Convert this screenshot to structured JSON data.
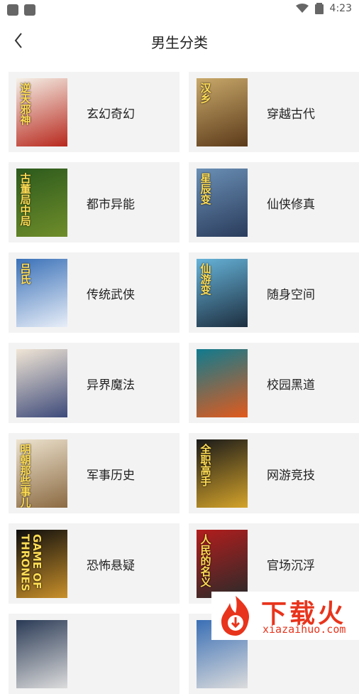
{
  "status_bar": {
    "time": "4:23"
  },
  "header": {
    "title": "男生分类",
    "back_icon": "chevron-left-icon"
  },
  "categories": [
    {
      "label": "玄幻奇幻",
      "cover_text": "逆天邪神",
      "cover_colors": [
        "#f5f1e8",
        "#b8281d"
      ]
    },
    {
      "label": "穿越古代",
      "cover_text": "汉乡",
      "cover_colors": [
        "#c9a96a",
        "#5b3a1a"
      ]
    },
    {
      "label": "都市异能",
      "cover_text": "古董局中局",
      "cover_colors": [
        "#2c5a1d",
        "#6f8d2a"
      ]
    },
    {
      "label": "仙侠修真",
      "cover_text": "星辰变",
      "cover_colors": [
        "#6a8fb5",
        "#2a3c5c"
      ]
    },
    {
      "label": "传统武侠",
      "cover_text": "吕氏",
      "cover_colors": [
        "#3a71b8",
        "#e8eef8"
      ]
    },
    {
      "label": "随身空间",
      "cover_text": "仙游变",
      "cover_colors": [
        "#66b3d9",
        "#1d2e3f"
      ]
    },
    {
      "label": "异界魔法",
      "cover_text": "",
      "cover_colors": [
        "#f1e6d6",
        "#3d4a7a"
      ]
    },
    {
      "label": "校园黑道",
      "cover_text": "",
      "cover_colors": [
        "#0f7b8f",
        "#e25a1c"
      ]
    },
    {
      "label": "军事历史",
      "cover_text": "明朝那些事儿",
      "cover_colors": [
        "#ede3cf",
        "#8b6a42"
      ]
    },
    {
      "label": "网游竞技",
      "cover_text": "全职高手",
      "cover_colors": [
        "#1a1a1a",
        "#d4a32a"
      ]
    },
    {
      "label": "恐怖悬疑",
      "cover_text": "GAME OF THRONES",
      "cover_colors": [
        "#0d0d0d",
        "#c9902a"
      ]
    },
    {
      "label": "官场沉浮",
      "cover_text": "人民的名义",
      "cover_colors": [
        "#b31d1d",
        "#2a2a2a"
      ]
    },
    {
      "label": "",
      "cover_text": "",
      "cover_colors": [
        "#2a3a55",
        "#dcdcdc"
      ]
    },
    {
      "label": "",
      "cover_text": "",
      "cover_colors": [
        "#3a6fb5",
        "#dcdcdc"
      ]
    }
  ],
  "watermark": {
    "brand": "下载火",
    "url": "xiazaihuo.com",
    "color": "#e8341c"
  }
}
